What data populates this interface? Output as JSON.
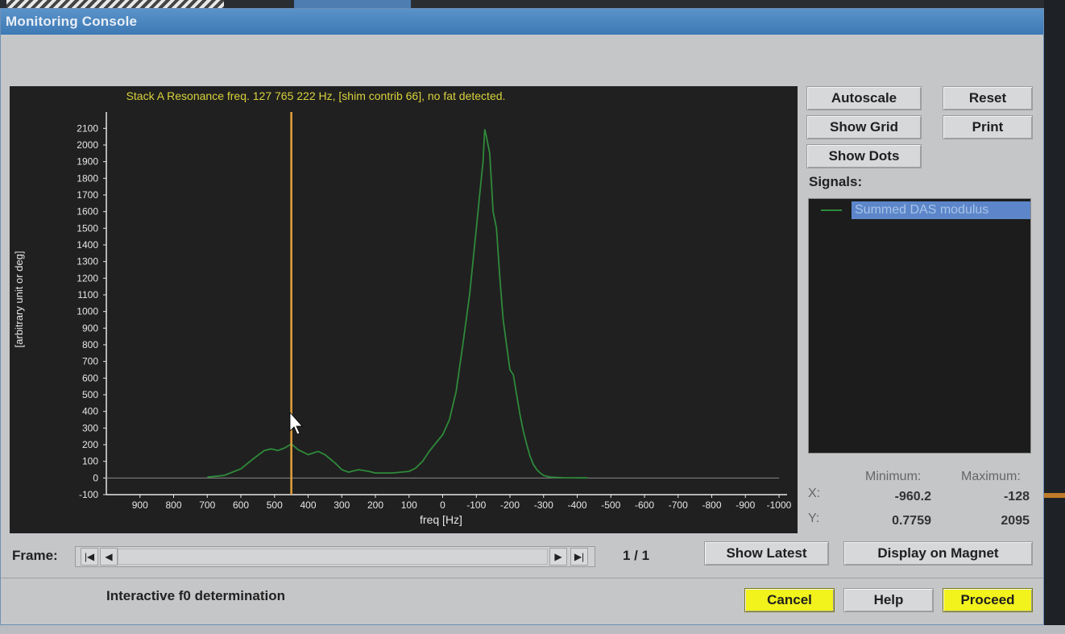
{
  "window": {
    "title": "Monitoring Console"
  },
  "plot": {
    "title": "Stack A Resonance freq. 127 765 222 Hz, [shim contrib 66], no fat detected.",
    "cursor_freq_hz": 450
  },
  "buttons": {
    "autoscale": "Autoscale",
    "reset": "Reset",
    "show_grid": "Show Grid",
    "print": "Print",
    "show_dots": "Show Dots",
    "show_latest": "Show Latest",
    "display_on_magnet": "Display on Magnet",
    "cancel": "Cancel",
    "help": "Help",
    "proceed": "Proceed"
  },
  "signals": {
    "label": "Signals:",
    "items": [
      {
        "name": "Summed DAS modulus",
        "color": "#2e8a3a",
        "selected": true
      }
    ]
  },
  "range": {
    "min_label": "Minimum:",
    "max_label": "Maximum:",
    "x_label": "X:",
    "y_label": "Y:",
    "x_min": "-960.2",
    "x_max": "-128",
    "y_min": "0.7759",
    "y_max": "2095"
  },
  "frame": {
    "label": "Frame:",
    "counter": "1 / 1",
    "first_icon": "first-frame-icon",
    "prev_icon": "prev-frame-icon",
    "next_icon": "next-frame-icon",
    "last_icon": "last-frame-icon"
  },
  "status": {
    "text": "Interactive f0 determination"
  },
  "chart_data": {
    "type": "line",
    "xlabel": "freq [Hz]",
    "ylabel": "[arbitrary unit or deg]",
    "xlim": [
      1000,
      -1000
    ],
    "ylim": [
      -100,
      2150
    ],
    "x_ticks": [
      "900",
      "800",
      "700",
      "600",
      "500",
      "400",
      "300",
      "200",
      "100",
      "0",
      "-100",
      "-200",
      "-300",
      "-400",
      "-500",
      "-600",
      "-700",
      "-800",
      "-900",
      "-1000"
    ],
    "y_ticks": [
      "-100",
      "0",
      "100",
      "200",
      "300",
      "400",
      "500",
      "600",
      "700",
      "800",
      "900",
      "1000",
      "1100",
      "1200",
      "1300",
      "1400",
      "1500",
      "1600",
      "1700",
      "1800",
      "1900",
      "2000",
      "2100"
    ],
    "grid": false,
    "series": [
      {
        "name": "Summed DAS modulus",
        "color": "#2e8a3a",
        "x": [
          700,
          650,
          600,
          560,
          530,
          510,
          490,
          470,
          450,
          430,
          400,
          370,
          350,
          320,
          300,
          280,
          250,
          220,
          200,
          150,
          100,
          80,
          60,
          40,
          20,
          0,
          -20,
          -40,
          -60,
          -80,
          -100,
          -110,
          -120,
          -125,
          -130,
          -140,
          -150,
          -160,
          -170,
          -180,
          -190,
          -200,
          -210,
          -220,
          -230,
          -240,
          -250,
          -260,
          -270,
          -280,
          -290,
          -300,
          -320,
          -340,
          -360,
          -380,
          -400,
          -430
        ],
        "y": [
          5,
          15,
          55,
          120,
          165,
          175,
          165,
          180,
          205,
          170,
          140,
          160,
          140,
          90,
          50,
          35,
          50,
          40,
          30,
          30,
          40,
          60,
          100,
          160,
          210,
          260,
          350,
          520,
          800,
          1100,
          1500,
          1700,
          1900,
          2095,
          2050,
          1950,
          1600,
          1500,
          1200,
          950,
          800,
          650,
          620,
          500,
          380,
          280,
          200,
          130,
          80,
          50,
          30,
          15,
          5,
          3,
          1,
          1,
          0.8,
          0.8
        ]
      }
    ]
  }
}
